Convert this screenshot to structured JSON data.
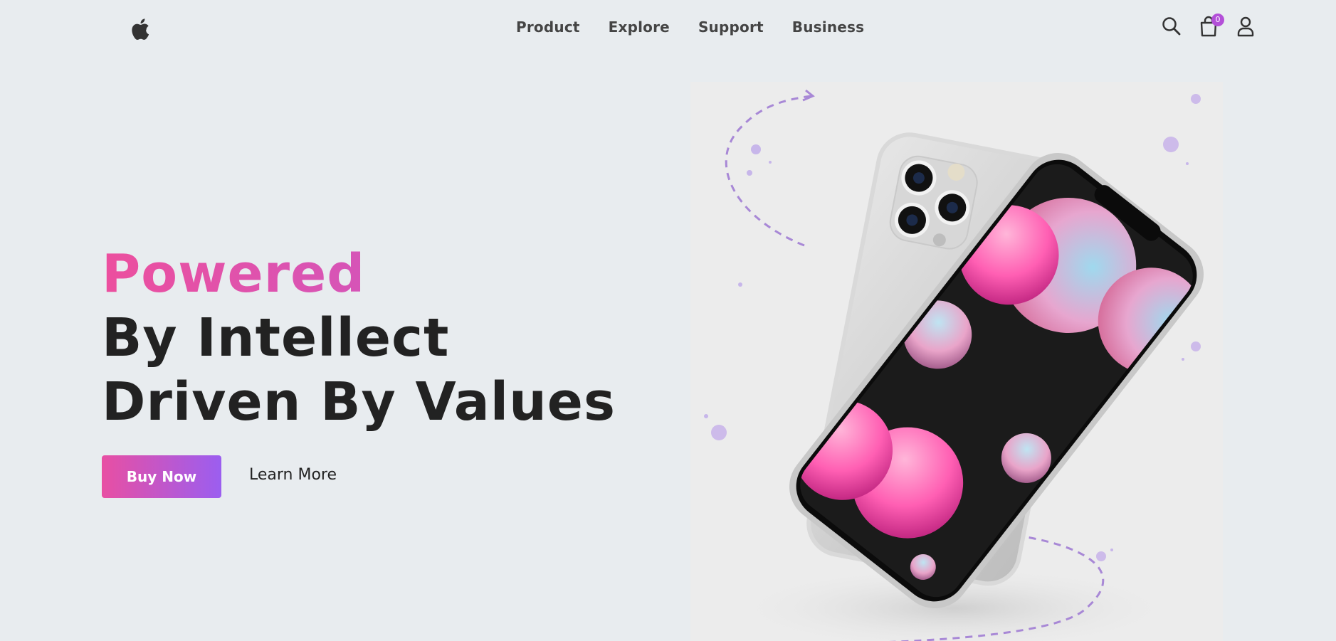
{
  "nav": {
    "logo_icon": "apple-logo",
    "items": [
      {
        "label": "Product"
      },
      {
        "label": "Explore"
      },
      {
        "label": "Support"
      },
      {
        "label": "Business"
      }
    ],
    "icons": {
      "search": "search-icon",
      "cart": "shopping-bag-icon",
      "account": "user-icon"
    },
    "cart_count": "0"
  },
  "hero": {
    "line1": "Powered",
    "line2": "By Intellect",
    "line3": "Driven By Values",
    "buy_label": "Buy Now",
    "more_label": "Learn More"
  },
  "colors": {
    "accent_pink": "#ec4f9e",
    "accent_purple": "#9b5ef0",
    "badge": "#b34fd8",
    "background": "#e8ecef"
  }
}
